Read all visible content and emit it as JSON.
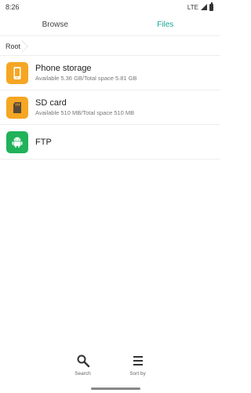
{
  "status": {
    "time": "8:26",
    "network": "LTE"
  },
  "tabs": [
    {
      "label": "Browse",
      "active": false
    },
    {
      "label": "Files",
      "active": true
    }
  ],
  "breadcrumb": {
    "root": "Root"
  },
  "items": [
    {
      "title": "Phone storage",
      "subtitle": "Available 5.36 GB/Total space 5.81 GB",
      "icon": "phone-icon",
      "color": "#f5a623"
    },
    {
      "title": "SD card",
      "subtitle": "Available 510 MB/Total space 510 MB",
      "icon": "sd-card-icon",
      "color": "#f5a623"
    },
    {
      "title": "FTP",
      "subtitle": "",
      "icon": "android-icon",
      "color": "#21b25a"
    }
  ],
  "toolbar": {
    "search_label": "Search",
    "sort_label": "Sort by"
  },
  "colors": {
    "accent": "#1aa79a"
  }
}
